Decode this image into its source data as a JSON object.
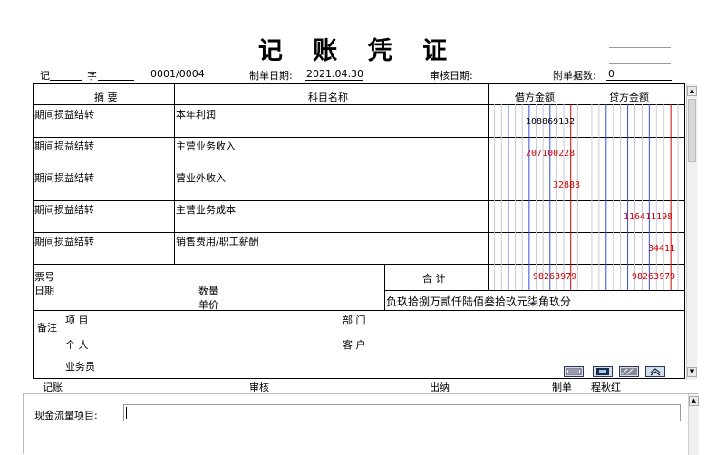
{
  "voucher": {
    "title": "记 账 凭 证",
    "type_label": "记",
    "word_label": "字",
    "number": "0001/0004",
    "prepare_date_label": "制单日期:",
    "prepare_date": "2021.04.30",
    "audit_date_label": "审核日期:",
    "attachments_label": "附单据数:",
    "attachments": "0"
  },
  "table": {
    "headers": {
      "summary": "摘 要",
      "account": "科目名称",
      "debit": "借方金额",
      "credit": "贷方金额"
    },
    "rows": [
      {
        "summary": "期间损益结转",
        "account": "本年利润",
        "debit": "108869132",
        "credit": "",
        "debit_color": "black"
      },
      {
        "summary": "期间损益结转",
        "account": "主营业务收入",
        "debit": "207100228",
        "credit": "",
        "debit_color": "red"
      },
      {
        "summary": "期间损益结转",
        "account": "营业外收入",
        "debit": "32883",
        "credit": "",
        "debit_color": "red"
      },
      {
        "summary": "期间损益结转",
        "account": "主营业务成本",
        "debit": "",
        "credit": "116411198",
        "debit_color": "red"
      },
      {
        "summary": "期间损益结转",
        "account": "销售费用/职工薪酬",
        "debit": "",
        "credit": "34411",
        "debit_color": "red"
      }
    ]
  },
  "footer": {
    "ticket_no_label": "票号",
    "date_label": "日期",
    "quantity_label": "数量",
    "unit_price_label": "单价",
    "total_label": "合 计",
    "total_debit": "98263979",
    "total_credit": "98263979",
    "amount_in_words": "负玖拾捌万贰仟陆佰叁拾玖元柒角玖分",
    "remarks_label": "备注",
    "project_label": "项 目",
    "department_label": "部 门",
    "person_label": "个 人",
    "customer_label": "客 户",
    "salesman_label": "业务员"
  },
  "signatures": {
    "bookkeeper_label": "记账",
    "audit_label": "审核",
    "cashier_label": "出纳",
    "maker_label": "制单",
    "maker_name": "程秋红"
  },
  "cashflow": {
    "label": "现金流量项目:",
    "value": ""
  },
  "icons": [
    "notepad-icon",
    "card-icon",
    "pattern-icon",
    "collapse-up-icon"
  ],
  "colors": {
    "grid_blue": "#3050d8",
    "grid_red": "#d00000",
    "negative": "#d00000"
  }
}
